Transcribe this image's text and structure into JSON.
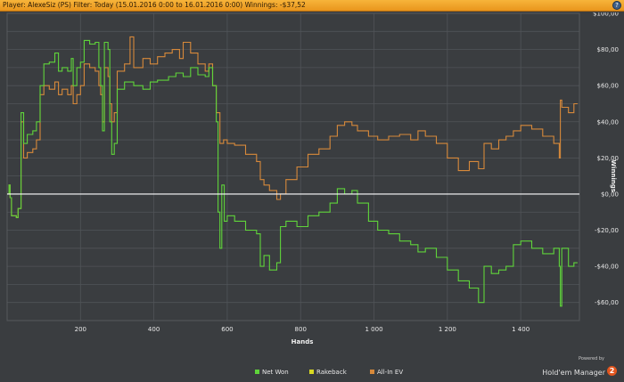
{
  "header": {
    "title": "Player: AlexeSiz (PS)  Filter: Today (15.01.2016 0:00 to 16.01.2016 0:00)  Winnings: -$37,52",
    "help_label": "?"
  },
  "branding": {
    "powered_by": "Powered by",
    "product": "Hold'em Manager",
    "badge": "2"
  },
  "colors": {
    "net_won": "#5fd43a",
    "rakeback": "#d8d822",
    "all_in_ev": "#d7893a",
    "zero_line": "#ffffff",
    "grid": "#505458",
    "plot_bg": "#3a3d40"
  },
  "chart_data": {
    "type": "line",
    "xlabel": "Hands",
    "ylabel": "Winnings",
    "xlim": [
      0,
      1560
    ],
    "ylim": [
      -70,
      100
    ],
    "x_ticks": [
      {
        "value": 200,
        "label": "200"
      },
      {
        "value": 400,
        "label": "400"
      },
      {
        "value": 600,
        "label": "600"
      },
      {
        "value": 800,
        "label": "800"
      },
      {
        "value": 1000,
        "label": "1 000"
      },
      {
        "value": 1200,
        "label": "1 200"
      },
      {
        "value": 1400,
        "label": "1 400"
      }
    ],
    "y_ticks": [
      {
        "value": 100,
        "label": "$100,00"
      },
      {
        "value": 80,
        "label": "$80,00"
      },
      {
        "value": 60,
        "label": "$60,00"
      },
      {
        "value": 40,
        "label": "$40,00"
      },
      {
        "value": 20,
        "label": "$20,00"
      },
      {
        "value": 0,
        "label": "$0,00"
      },
      {
        "value": -20,
        "label": "-$20,00"
      },
      {
        "value": -40,
        "label": "-$40,00"
      },
      {
        "value": -60,
        "label": "-$60,00"
      }
    ],
    "grid": true,
    "legend_position": "bottom-center",
    "legend": [
      "Net Won",
      "Rakeback",
      "All-In EV"
    ],
    "series": [
      {
        "name": "Net Won",
        "points": [
          [
            0,
            0
          ],
          [
            5,
            5
          ],
          [
            8,
            -2
          ],
          [
            12,
            -12
          ],
          [
            25,
            -13
          ],
          [
            30,
            -8
          ],
          [
            38,
            45
          ],
          [
            45,
            28
          ],
          [
            55,
            33
          ],
          [
            70,
            35
          ],
          [
            80,
            40
          ],
          [
            90,
            60
          ],
          [
            100,
            72
          ],
          [
            115,
            73
          ],
          [
            130,
            78
          ],
          [
            140,
            68
          ],
          [
            150,
            70
          ],
          [
            165,
            68
          ],
          [
            175,
            75
          ],
          [
            180,
            60
          ],
          [
            190,
            70
          ],
          [
            200,
            73
          ],
          [
            210,
            85
          ],
          [
            225,
            83
          ],
          [
            240,
            84
          ],
          [
            250,
            70
          ],
          [
            255,
            60
          ],
          [
            260,
            35
          ],
          [
            265,
            84
          ],
          [
            275,
            80
          ],
          [
            280,
            40
          ],
          [
            285,
            22
          ],
          [
            292,
            28
          ],
          [
            300,
            58
          ],
          [
            320,
            62
          ],
          [
            345,
            60
          ],
          [
            370,
            58
          ],
          [
            390,
            62
          ],
          [
            410,
            63
          ],
          [
            440,
            65
          ],
          [
            460,
            67
          ],
          [
            480,
            65
          ],
          [
            500,
            70
          ],
          [
            520,
            66
          ],
          [
            540,
            65
          ],
          [
            550,
            70
          ],
          [
            560,
            60
          ],
          [
            570,
            40
          ],
          [
            575,
            -10
          ],
          [
            580,
            -30
          ],
          [
            585,
            5
          ],
          [
            592,
            -15
          ],
          [
            600,
            -12
          ],
          [
            620,
            -15
          ],
          [
            650,
            -20
          ],
          [
            680,
            -22
          ],
          [
            690,
            -40
          ],
          [
            700,
            -34
          ],
          [
            715,
            -42
          ],
          [
            735,
            -38
          ],
          [
            745,
            -18
          ],
          [
            760,
            -15
          ],
          [
            790,
            -18
          ],
          [
            820,
            -12
          ],
          [
            850,
            -10
          ],
          [
            880,
            -5
          ],
          [
            900,
            3
          ],
          [
            920,
            0
          ],
          [
            940,
            2
          ],
          [
            955,
            -5
          ],
          [
            985,
            -15
          ],
          [
            1010,
            -20
          ],
          [
            1040,
            -22
          ],
          [
            1070,
            -26
          ],
          [
            1100,
            -28
          ],
          [
            1120,
            -32
          ],
          [
            1140,
            -30
          ],
          [
            1170,
            -35
          ],
          [
            1200,
            -42
          ],
          [
            1230,
            -48
          ],
          [
            1260,
            -52
          ],
          [
            1285,
            -60
          ],
          [
            1300,
            -40
          ],
          [
            1320,
            -44
          ],
          [
            1340,
            -42
          ],
          [
            1360,
            -40
          ],
          [
            1380,
            -28
          ],
          [
            1400,
            -26
          ],
          [
            1430,
            -30
          ],
          [
            1460,
            -33
          ],
          [
            1490,
            -30
          ],
          [
            1505,
            -40
          ],
          [
            1508,
            -62
          ],
          [
            1512,
            -30
          ],
          [
            1530,
            -40
          ],
          [
            1545,
            -38
          ],
          [
            1555,
            -38
          ]
        ]
      },
      {
        "name": "All-In EV",
        "points": [
          [
            0,
            0
          ],
          [
            5,
            5
          ],
          [
            8,
            -2
          ],
          [
            12,
            -12
          ],
          [
            25,
            -13
          ],
          [
            30,
            -8
          ],
          [
            38,
            40
          ],
          [
            45,
            20
          ],
          [
            55,
            23
          ],
          [
            70,
            25
          ],
          [
            80,
            30
          ],
          [
            90,
            55
          ],
          [
            100,
            60
          ],
          [
            115,
            58
          ],
          [
            130,
            62
          ],
          [
            140,
            55
          ],
          [
            150,
            58
          ],
          [
            165,
            55
          ],
          [
            175,
            60
          ],
          [
            180,
            50
          ],
          [
            190,
            55
          ],
          [
            200,
            60
          ],
          [
            210,
            72
          ],
          [
            225,
            70
          ],
          [
            240,
            68
          ],
          [
            250,
            60
          ],
          [
            255,
            55
          ],
          [
            260,
            40
          ],
          [
            265,
            70
          ],
          [
            275,
            65
          ],
          [
            280,
            50
          ],
          [
            285,
            40
          ],
          [
            292,
            45
          ],
          [
            300,
            68
          ],
          [
            320,
            72
          ],
          [
            335,
            87
          ],
          [
            345,
            70
          ],
          [
            370,
            75
          ],
          [
            390,
            72
          ],
          [
            410,
            76
          ],
          [
            430,
            78
          ],
          [
            450,
            80
          ],
          [
            470,
            75
          ],
          [
            480,
            84
          ],
          [
            500,
            78
          ],
          [
            520,
            72
          ],
          [
            540,
            68
          ],
          [
            550,
            72
          ],
          [
            560,
            60
          ],
          [
            570,
            45
          ],
          [
            580,
            28
          ],
          [
            590,
            30
          ],
          [
            600,
            28
          ],
          [
            620,
            27
          ],
          [
            650,
            22
          ],
          [
            680,
            18
          ],
          [
            690,
            8
          ],
          [
            700,
            5
          ],
          [
            715,
            2
          ],
          [
            735,
            -3
          ],
          [
            745,
            0
          ],
          [
            760,
            8
          ],
          [
            790,
            15
          ],
          [
            820,
            22
          ],
          [
            850,
            25
          ],
          [
            880,
            32
          ],
          [
            900,
            38
          ],
          [
            920,
            40
          ],
          [
            940,
            38
          ],
          [
            955,
            35
          ],
          [
            985,
            32
          ],
          [
            1010,
            30
          ],
          [
            1040,
            32
          ],
          [
            1070,
            33
          ],
          [
            1100,
            30
          ],
          [
            1120,
            35
          ],
          [
            1140,
            32
          ],
          [
            1170,
            28
          ],
          [
            1200,
            20
          ],
          [
            1230,
            13
          ],
          [
            1260,
            18
          ],
          [
            1285,
            14
          ],
          [
            1300,
            28
          ],
          [
            1320,
            25
          ],
          [
            1340,
            30
          ],
          [
            1360,
            32
          ],
          [
            1380,
            35
          ],
          [
            1400,
            38
          ],
          [
            1430,
            36
          ],
          [
            1460,
            32
          ],
          [
            1490,
            28
          ],
          [
            1505,
            20
          ],
          [
            1508,
            52
          ],
          [
            1512,
            48
          ],
          [
            1530,
            45
          ],
          [
            1545,
            50
          ],
          [
            1555,
            50
          ]
        ]
      },
      {
        "name": "Rakeback",
        "points": []
      }
    ]
  }
}
